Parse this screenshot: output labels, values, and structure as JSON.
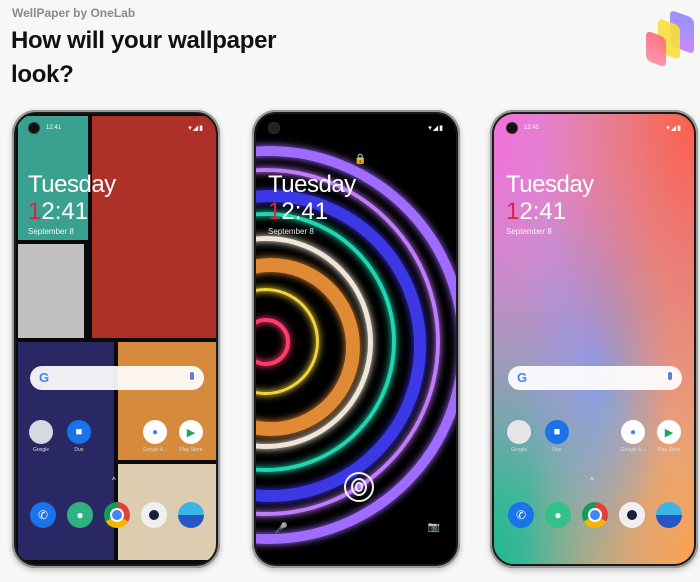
{
  "header": {
    "brand": "WellPaper by OneLab",
    "title": "How will your wallpaper look?"
  },
  "colors": {
    "mondrian": {
      "teal": "#3aa08f",
      "red": "#ae3129",
      "gray": "#c0c0c0",
      "navy": "#2a2864",
      "orange": "#d58a3c",
      "beige": "#dccdb0"
    },
    "neon_rings": [
      "#ff3b6b",
      "#f2d43c",
      "#e08a35",
      "#f0e6d8",
      "#1fd6b0",
      "#3c38e6",
      "#c07cff",
      "#a06bff"
    ],
    "clock_accent": "#d3264a"
  },
  "phones": [
    {
      "name": "Mondrian tiles",
      "status_time": "12:41",
      "day": "Tuesday",
      "clock_first": "1",
      "clock_rest": "2:41",
      "date": "September 8",
      "apps": [
        {
          "label": "Google",
          "icon": "google-folder-icon"
        },
        {
          "label": "Duo",
          "icon": "duo-icon"
        },
        {
          "label": "Google A...",
          "icon": "google-assistant-icon"
        },
        {
          "label": "Play Store",
          "icon": "play-store-icon"
        }
      ],
      "dock": [
        "phone-icon",
        "messages-icon",
        "chrome-icon",
        "camera-icon",
        "gallery-icon"
      ]
    },
    {
      "name": "Neon rings",
      "status_time": "",
      "day": "Tuesday",
      "clock_first": "1",
      "clock_rest": "2:41",
      "date": "September 8"
    },
    {
      "name": "Gradient",
      "status_time": "12:41",
      "day": "Tuesday",
      "clock_first": "1",
      "clock_rest": "2:41",
      "date": "September 8",
      "apps": [
        {
          "label": "Google",
          "icon": "google-folder-icon"
        },
        {
          "label": "Duo",
          "icon": "duo-icon"
        },
        {
          "label": "Google A...",
          "icon": "google-assistant-icon"
        },
        {
          "label": "Play Store",
          "icon": "play-store-icon"
        }
      ],
      "dock": [
        "phone-icon",
        "messages-icon",
        "chrome-icon",
        "camera-icon",
        "gallery-icon"
      ]
    }
  ],
  "glyphs": {
    "google_g": "G",
    "swipe_up": "^",
    "phone": "✆",
    "messages": "●",
    "duo": "■",
    "play": "▶",
    "lock": "🔒",
    "mic": "🎤",
    "camera": "📷",
    "status": "▾◢▮"
  }
}
